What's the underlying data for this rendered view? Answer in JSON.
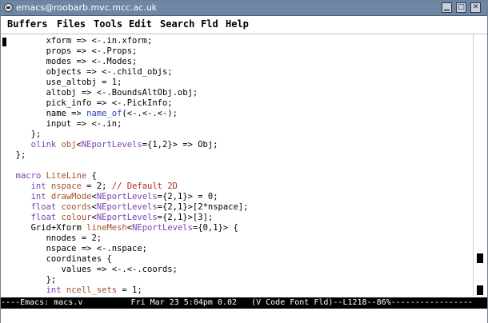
{
  "window": {
    "title": "emacs@roobarb.mvc.mcc.ac.uk",
    "colors": {
      "titlebar": "#6f86a3",
      "modeline": "#000000"
    }
  },
  "menubar": {
    "items": [
      "Buffers",
      "Files",
      "Tools",
      "Edit",
      "Search",
      "Fld",
      "Help"
    ]
  },
  "editor": {
    "lines": [
      [
        {
          "t": "        xform => <-.in.xform;",
          "c": ""
        }
      ],
      [
        {
          "t": "        props => <-.Props;",
          "c": ""
        }
      ],
      [
        {
          "t": "        modes => <-.Modes;",
          "c": ""
        }
      ],
      [
        {
          "t": "        objects => <-.child_objs;",
          "c": ""
        }
      ],
      [
        {
          "t": "        use_altobj = 1;",
          "c": ""
        }
      ],
      [
        {
          "t": "        altobj => <-.BoundsAltObj.obj;",
          "c": ""
        }
      ],
      [
        {
          "t": "        pick_info => <-.PickInfo;",
          "c": ""
        }
      ],
      [
        {
          "t": "        name => ",
          "c": ""
        },
        {
          "t": "name_of",
          "c": "ty2"
        },
        {
          "t": "(<-.<-.<-);",
          "c": ""
        }
      ],
      [
        {
          "t": "        input => <-.in;",
          "c": ""
        }
      ],
      [
        {
          "t": "     };",
          "c": ""
        }
      ],
      [
        {
          "t": "     ",
          "c": ""
        },
        {
          "t": "olink",
          "c": "ty"
        },
        {
          "t": " ",
          "c": ""
        },
        {
          "t": "obj",
          "c": "kw"
        },
        {
          "t": "<",
          "c": ""
        },
        {
          "t": "NEportLevels",
          "c": "ty"
        },
        {
          "t": "={1,2}> => Obj;",
          "c": ""
        }
      ],
      [
        {
          "t": "  };",
          "c": ""
        }
      ],
      [
        {
          "t": "",
          "c": ""
        }
      ],
      [
        {
          "t": "  ",
          "c": ""
        },
        {
          "t": "macro",
          "c": "ty"
        },
        {
          "t": " ",
          "c": ""
        },
        {
          "t": "LiteLine",
          "c": "kw"
        },
        {
          "t": " {",
          "c": ""
        }
      ],
      [
        {
          "t": "     ",
          "c": ""
        },
        {
          "t": "int",
          "c": "ty"
        },
        {
          "t": " ",
          "c": ""
        },
        {
          "t": "nspace",
          "c": "kw"
        },
        {
          "t": " = 2; ",
          "c": ""
        },
        {
          "t": "// Default 2D",
          "c": "cm"
        }
      ],
      [
        {
          "t": "     ",
          "c": ""
        },
        {
          "t": "int",
          "c": "ty"
        },
        {
          "t": " ",
          "c": ""
        },
        {
          "t": "drawMode",
          "c": "kw"
        },
        {
          "t": "<",
          "c": ""
        },
        {
          "t": "NEportLevels",
          "c": "ty"
        },
        {
          "t": "={2,1}> = 0;",
          "c": ""
        }
      ],
      [
        {
          "t": "     ",
          "c": ""
        },
        {
          "t": "float",
          "c": "ty"
        },
        {
          "t": " ",
          "c": ""
        },
        {
          "t": "coords",
          "c": "kw"
        },
        {
          "t": "<",
          "c": ""
        },
        {
          "t": "NEportLevels",
          "c": "ty"
        },
        {
          "t": "={2,1}>[2*nspace];",
          "c": ""
        }
      ],
      [
        {
          "t": "     ",
          "c": ""
        },
        {
          "t": "float",
          "c": "ty"
        },
        {
          "t": " ",
          "c": ""
        },
        {
          "t": "colour",
          "c": "kw"
        },
        {
          "t": "<",
          "c": ""
        },
        {
          "t": "NEportLevels",
          "c": "ty"
        },
        {
          "t": "={2,1}>[3];",
          "c": ""
        }
      ],
      [
        {
          "t": "     Grid+Xform ",
          "c": ""
        },
        {
          "t": "lineMesh",
          "c": "kw"
        },
        {
          "t": "<",
          "c": ""
        },
        {
          "t": "NEportLevels",
          "c": "ty"
        },
        {
          "t": "={0,1}> {",
          "c": ""
        }
      ],
      [
        {
          "t": "        nnodes = 2;",
          "c": ""
        }
      ],
      [
        {
          "t": "        nspace => <-.nspace;",
          "c": ""
        }
      ],
      [
        {
          "t": "        coordinates {",
          "c": ""
        }
      ],
      [
        {
          "t": "           values => <-.<-.coords;",
          "c": ""
        }
      ],
      [
        {
          "t": "        };",
          "c": ""
        }
      ],
      [
        {
          "t": "        ",
          "c": ""
        },
        {
          "t": "int",
          "c": "ty"
        },
        {
          "t": " ",
          "c": ""
        },
        {
          "t": "ncell_sets",
          "c": "kw"
        },
        {
          "t": " = 1;",
          "c": ""
        }
      ]
    ]
  },
  "modeline": {
    "text": "----Emacs: macs.v          Fri Mar 23 5:04pm 0.02   (V Code Font Fld)--L1218--86%-----------------"
  }
}
